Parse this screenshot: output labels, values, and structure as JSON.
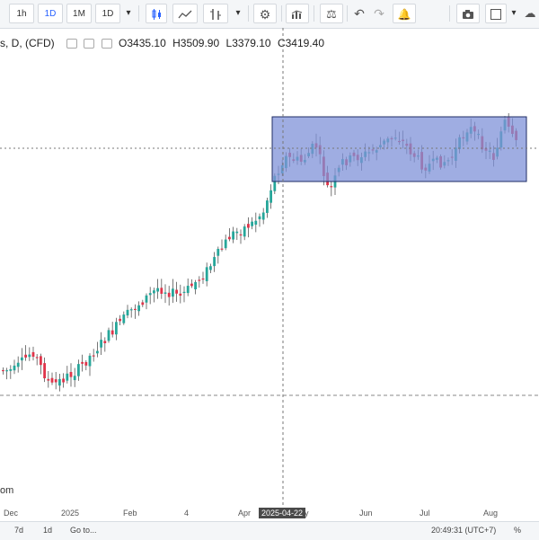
{
  "toolbar": {
    "intervals": [
      "1h",
      "1D",
      "1M",
      "1D"
    ],
    "active_interval": "1D",
    "icons": [
      "chevron-down-icon",
      "candles-icon",
      "indicator-icon",
      "compare-icon",
      "chevron-down-icon",
      "settings-gear-icon",
      "bars-icon",
      "scale-icon",
      "undo-icon",
      "redo-icon",
      "alert-add-icon",
      "camera-icon",
      "square-icon",
      "chevron-down-icon",
      "cloud-icon"
    ]
  },
  "legend": {
    "symbol": "s, D, (CFD)",
    "open_label": "O",
    "open": "3435.10",
    "high_label": "H",
    "high": "3509.90",
    "low_label": "L",
    "low": "3379.10",
    "close_label": "C",
    "close": "3419.40"
  },
  "x_axis": {
    "ticks": [
      "Dec",
      "2025",
      "Feb",
      "4",
      "Apr",
      "2025-04-22",
      "y",
      "Jun",
      "Jul",
      "Aug"
    ],
    "crosshair_label": "2025-04-22"
  },
  "watermark": "om",
  "bottom_bar": {
    "ranges": [
      "7d",
      "1d"
    ],
    "goto": "Go to...",
    "time": "20:49:31 (UTC+7)",
    "percent": "%"
  },
  "colors": {
    "up": "#26a69a",
    "down": "#e0344a",
    "wick": "#555555",
    "rectangle_fill": "#7f92d8",
    "rectangle_border": "#1f2d66",
    "active": "#2962ff"
  },
  "chart_data": {
    "type": "candlestick",
    "x": [
      "Dec",
      "2025",
      "Feb",
      "4",
      "Apr",
      "2025-04-22",
      "y",
      "Jun",
      "Jul",
      "Aug"
    ],
    "close": [
      2630,
      2620,
      2740,
      2800,
      2900,
      3000,
      3050,
      3120,
      3150,
      3050,
      3350,
      3420
    ],
    "range_box": {
      "from": "2025-04-22",
      "low": 3200,
      "high": 3510
    }
  }
}
